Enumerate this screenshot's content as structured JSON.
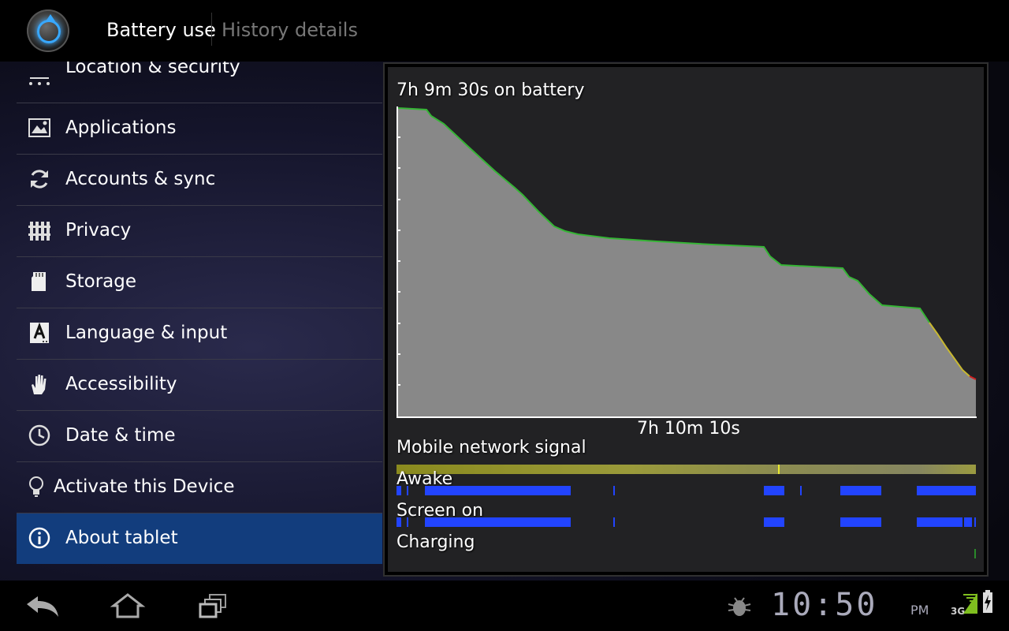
{
  "actionbar": {
    "tabs": [
      {
        "label": "Battery use",
        "active": true
      },
      {
        "label": "History details",
        "active": false
      }
    ]
  },
  "settings_list": {
    "items": [
      {
        "label": "Location & security",
        "icon": "location-icon"
      },
      {
        "label": "Applications",
        "icon": "applications-icon"
      },
      {
        "label": "Accounts & sync",
        "icon": "sync-icon"
      },
      {
        "label": "Privacy",
        "icon": "privacy-icon"
      },
      {
        "label": "Storage",
        "icon": "storage-icon"
      },
      {
        "label": "Language & input",
        "icon": "language-icon"
      },
      {
        "label": "Accessibility",
        "icon": "hand-icon"
      },
      {
        "label": "Date & time",
        "icon": "clock-icon"
      },
      {
        "label": "Activate this Device",
        "icon": "bulb-icon"
      },
      {
        "label": "About tablet",
        "icon": "info-icon",
        "selected": true
      }
    ]
  },
  "battery": {
    "title": "7h 9m 30s on battery",
    "duration_label": "7h 10m 10s",
    "lanes": [
      "Mobile network signal",
      "Awake",
      "Screen on",
      "Charging"
    ],
    "colors": {
      "fill": "#888888",
      "line": "#35b535",
      "line_low": "#c8b830",
      "line_critical": "#d02020",
      "lane_bar": "#2244ff"
    }
  },
  "sysbar": {
    "clock": "10:50",
    "ampm": "PM",
    "network": "3G"
  }
}
